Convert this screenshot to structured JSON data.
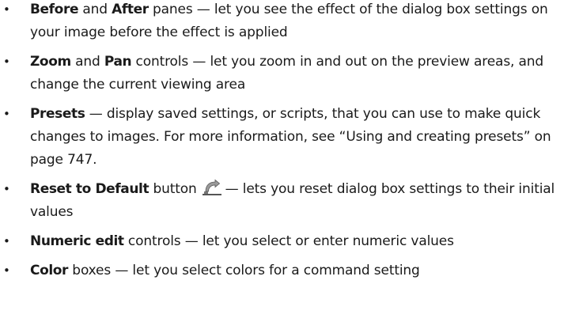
{
  "bullet_glyph": "•",
  "items": [
    {
      "term1": "Before",
      "joiner": " and ",
      "term2": "After",
      "desc": " panes — let you see the effect of the dialog box settings on your image before the effect is applied"
    },
    {
      "term1": "Zoom",
      "joiner": " and ",
      "term2": "Pan",
      "desc": " controls — let you zoom in and out on the preview areas, and change the current viewing area"
    },
    {
      "term": "Presets",
      "desc": " — display saved settings, or scripts, that you can use to make quick changes to images. For more information, see “Using and creating presets” on page 747."
    },
    {
      "term": "Reset to Default",
      "desc_before_icon": " button",
      "icon": "reset-to-default-icon",
      "desc_after_icon": "— lets you reset dialog box settings to their initial values"
    },
    {
      "term": "Numeric edit",
      "desc": " controls — let you select or enter numeric values"
    },
    {
      "term": "Color",
      "desc": " boxes — let you select colors for a command setting"
    }
  ]
}
